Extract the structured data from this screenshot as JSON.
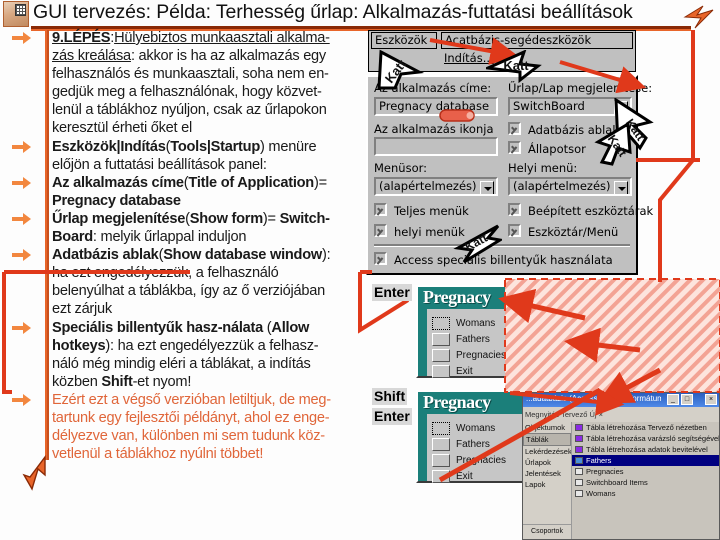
{
  "header": {
    "title": "GUI tervezés: Példa: Terhesség űrlap: Alkalmazás-futtatási beállítások",
    "thumb_alt": "slide-thumbnail"
  },
  "colors": {
    "accent_orange": "#e8652a",
    "rule_dark": "#8a2a06",
    "annotation_red": "#e0391b",
    "dialog_face": "#c0c0c0",
    "form_titlebar": "#1b7f7a",
    "body_text": "#1a1a1a",
    "orange_text": "#e0663a"
  },
  "body_lines": [
    {
      "bullet": true,
      "parts": [
        {
          "t": "9.LÉPÉS",
          "s": "bu"
        },
        {
          "t": ":",
          "s": ""
        },
        {
          "t": "Hülyebiztos munkaasztali alkalma-",
          "s": "u"
        }
      ]
    },
    {
      "bullet": false,
      "parts": [
        {
          "t": "zás kreálása",
          "s": "u"
        },
        {
          "t": ": akkor is ha az alkalmazás egy",
          "s": ""
        }
      ]
    },
    {
      "bullet": false,
      "parts": [
        {
          "t": "felhasználós és munkaasztali, soha nem en-",
          "s": ""
        }
      ]
    },
    {
      "bullet": false,
      "parts": [
        {
          "t": "gedjük meg a felhasználónak, hogy közvet-",
          "s": ""
        }
      ]
    },
    {
      "bullet": false,
      "parts": [
        {
          "t": "lenül a táblákhoz nyúljon, csak az űrlapokon",
          "s": ""
        }
      ]
    },
    {
      "bullet": false,
      "parts": [
        {
          "t": "keresztül érheti őket el",
          "s": ""
        }
      ]
    },
    {
      "bullet": true,
      "parts": [
        {
          "t": "Eszközök|Indítás",
          "s": "b"
        },
        {
          "t": "(",
          "s": ""
        },
        {
          "t": "Tools|Startup",
          "s": "b"
        },
        {
          "t": ") menüre",
          "s": ""
        }
      ]
    },
    {
      "bullet": false,
      "parts": [
        {
          "t": "előjön a futtatási beállítások panel:",
          "s": ""
        }
      ]
    },
    {
      "bullet": true,
      "parts": [
        {
          "t": "Az alkalmazás címe",
          "s": "b"
        },
        {
          "t": "(",
          "s": ""
        },
        {
          "t": "Title of Application",
          "s": "b"
        },
        {
          "t": ")=",
          "s": ""
        }
      ]
    },
    {
      "bullet": false,
      "parts": [
        {
          "t": "Pregnacy database",
          "s": "b"
        }
      ]
    },
    {
      "bullet": true,
      "parts": [
        {
          "t": "Űrlap megjelenítése",
          "s": "b"
        },
        {
          "t": "(",
          "s": ""
        },
        {
          "t": "Show form",
          "s": "b"
        },
        {
          "t": ")= ",
          "s": ""
        },
        {
          "t": "Switch-",
          "s": "b"
        }
      ]
    },
    {
      "bullet": false,
      "parts": [
        {
          "t": "Board",
          "s": "b"
        },
        {
          "t": ": melyik űrlappal induljon",
          "s": ""
        }
      ]
    },
    {
      "bullet": true,
      "parts": [
        {
          "t": "Adatbázis ablak",
          "s": "b"
        },
        {
          "t": "(",
          "s": ""
        },
        {
          "t": "Show database window",
          "s": "b"
        },
        {
          "t": "):",
          "s": ""
        }
      ]
    },
    {
      "bullet": false,
      "parts": [
        {
          "t": "ha ezt engedélyezzük, a felhasználó",
          "s": ""
        }
      ]
    },
    {
      "bullet": false,
      "parts": [
        {
          "t": "belenyúlhat a táblákba, így az ő verziójában",
          "s": ""
        }
      ]
    },
    {
      "bullet": false,
      "parts": [
        {
          "t": "ezt zárjuk",
          "s": ""
        }
      ]
    },
    {
      "bullet": true,
      "parts": [
        {
          "t": "Speciális billentyűk hasz-nálata",
          "s": "b"
        },
        {
          "t": " (",
          "s": ""
        },
        {
          "t": "Allow",
          "s": "b"
        }
      ]
    },
    {
      "bullet": false,
      "parts": [
        {
          "t": "hotkeys",
          "s": "b"
        },
        {
          "t": "): ha ezt engedélyezzük a felhasz-",
          "s": ""
        }
      ]
    },
    {
      "bullet": false,
      "parts": [
        {
          "t": "náló még mindig eléri a táblákat, a indítás",
          "s": ""
        }
      ]
    },
    {
      "bullet": false,
      "parts": [
        {
          "t": "közben ",
          "s": ""
        },
        {
          "t": "Shift",
          "s": "b"
        },
        {
          "t": "-et nyom!",
          "s": ""
        }
      ]
    },
    {
      "bullet": true,
      "parts": [
        {
          "t": "Ezért ezt a végső verzióban letiltjuk, de meg-",
          "s": "o"
        }
      ]
    },
    {
      "bullet": false,
      "parts": [
        {
          "t": "tartunk egy fejlesztői példányt, ahol ez enge-",
          "s": "o"
        }
      ]
    },
    {
      "bullet": false,
      "parts": [
        {
          "t": "délyezve van, különben mi sem tudunk köz-",
          "s": "o"
        }
      ]
    },
    {
      "bullet": false,
      "parts": [
        {
          "t": "vetlenül a táblákhoz nyúlni többet!",
          "s": "o"
        }
      ]
    }
  ],
  "menu": {
    "tools_label": "Eszközök",
    "submenu_label": "Acatbázis-segédeszközök",
    "startup_label": "Indítás..."
  },
  "dialog": {
    "app_title_label": "Az alkalmazás címe:",
    "app_title_value": "Pregnacy database",
    "show_form_label": "Űrlap/Lap megjelenítése:",
    "show_form_value": "SwitchBoard",
    "app_icon_label": "Az alkalmazás ikonja",
    "app_icon_value": "",
    "db_window_label": "Adatbázis ablak",
    "statusbar_label": "Állapotsor",
    "menubar_label": "Menüsor:",
    "localmenu_label": "Helyi menü:",
    "menubar_value": "(alapértelmezés)",
    "localmenu_value": "(alapértelmezés)",
    "full_menus_label": "Teljes menük",
    "builtin_toolbars_label": "Beépített eszköztárak",
    "local_menus_label": "helyi menük",
    "toolbar_menu_label": "Eszköztár/Menü",
    "hotkeys_label": "Access speciális billentyűk használata",
    "checks": {
      "db_window": true,
      "statusbar": true,
      "full_menus": true,
      "builtin_toolbars": true,
      "local_menus": true,
      "toolbar_menu": true,
      "hotkeys": true
    }
  },
  "switchboard": {
    "title": "Pregnacy",
    "items": [
      "Womans",
      "Fathers",
      "Pregnacies",
      "Exit"
    ]
  },
  "annotations": {
    "enter_label": "Enter",
    "shift_label": "Shift",
    "enter_label2": "Enter",
    "click_label": "Katt"
  },
  "access_window": {
    "title": "...adatbázis (Access 2000 fájlformátum...",
    "min_label": "_",
    "max_label": "□",
    "close_label": "×",
    "toolbar_text": "Megnyitás   Tervező   Új   ×   ",
    "sidebar": [
      "Objektumok",
      "Táblák",
      "Lekérdezések",
      "Űrlapok",
      "Jelentések",
      "Lapok"
    ],
    "sidebar_selected": "Táblák",
    "footer_label": "Csoportok",
    "list": [
      "Tábla létrehozása Tervező nézetben",
      "Tábla létrehozása varázsló segítségével",
      "Tábla létrehozása adatok bevitelével",
      "Fathers",
      "Pregnacies",
      "Switchboard Items",
      "Womans"
    ],
    "list_selected": "Fathers"
  }
}
